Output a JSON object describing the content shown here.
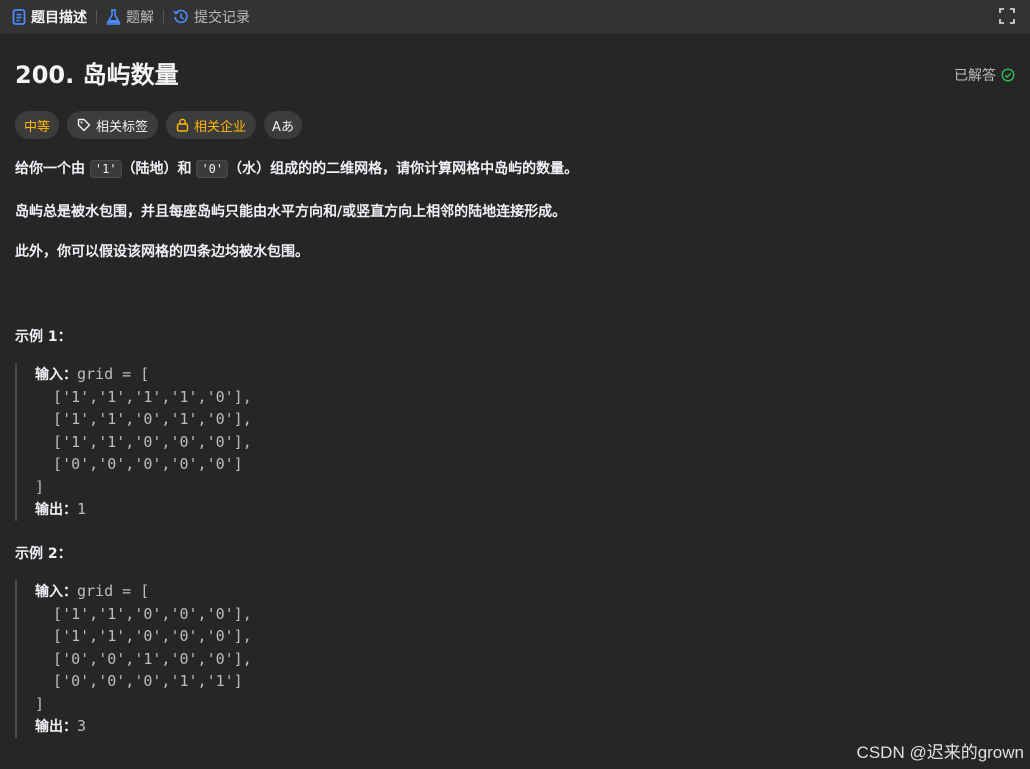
{
  "tabs": {
    "description": "题目描述",
    "solution": "题解",
    "submissions": "提交记录"
  },
  "problem": {
    "title": "200. 岛屿数量",
    "status": "已解答",
    "difficulty": "中等",
    "tag_related": "相关标签",
    "tag_company": "相关企业",
    "translate": "Aあ"
  },
  "description": {
    "p1_a": "给你一个由 ",
    "p1_code1": "'1'",
    "p1_b": "（陆地）和 ",
    "p1_code2": "'0'",
    "p1_c": "（水）组成的的二维网格，请你计算网格中岛屿的数量。",
    "p2": "岛屿总是被水包围，并且每座岛屿只能由水平方向和/或竖直方向上相邻的陆地连接形成。",
    "p3": "此外，你可以假设该网格的四条边均被水包围。"
  },
  "examples": [
    {
      "title": "示例 1：",
      "input_label": "输入：",
      "input_head": "grid = [",
      "rows": [
        "  ['1','1','1','1','0'],",
        "  ['1','1','0','1','0'],",
        "  ['1','1','0','0','0'],",
        "  ['0','0','0','0','0']"
      ],
      "input_tail": "]",
      "output_label": "输出：",
      "output": "1"
    },
    {
      "title": "示例 2：",
      "input_label": "输入：",
      "input_head": "grid = [",
      "rows": [
        "  ['1','1','0','0','0'],",
        "  ['1','1','0','0','0'],",
        "  ['0','0','1','0','0'],",
        "  ['0','0','0','1','1']"
      ],
      "input_tail": "]",
      "output_label": "输出：",
      "output": "3"
    }
  ],
  "watermark": "CSDN @迟来的grown",
  "colors": {
    "accent_blue": "#4a8cff",
    "medium": "#ffb800",
    "solved_green": "#2cbb5d"
  }
}
